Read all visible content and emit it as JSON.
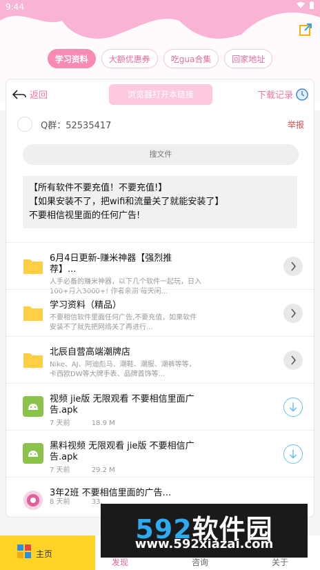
{
  "status_bar": {
    "time": "9:44"
  },
  "tabs": [
    {
      "label": "学习资料"
    },
    {
      "label": "大额优惠券"
    },
    {
      "label": "吃gua合集"
    },
    {
      "label": "回家地址"
    }
  ],
  "nav": {
    "back_label": "返回",
    "open_browser_label": "浏览器打开本链接",
    "download_label": "下载记录"
  },
  "group": {
    "qq_text": "Q群：52535417",
    "report_label": "举报"
  },
  "search": {
    "placeholder": "搜文件"
  },
  "notice": {
    "line1": "【所有软件不要充值！不要充值!】",
    "line2": "【如果安装不了，把wifi和流量关了就能安装了】",
    "line3": "不要相信视里面的任何广告!"
  },
  "files": [
    {
      "title": "6月4日更新-赚米神器【强烈推荐】...",
      "desc": "人手必备的赚米神器，以下几个软件一起玩，日入100+月入3000+! 作者亲测 每天闲...",
      "icon": "folder-icon",
      "action": "chevron-right-icon"
    },
    {
      "title": "学习资料（精品）",
      "desc": "不要相信软件里面任何广告,不要充值，如果软件安装不了就先把网络关了再进行...",
      "icon": "folder-icon",
      "action": "chevron-right-icon"
    },
    {
      "title": "北辰自营高端潮牌店",
      "desc": "Nike、AJ、阿迪彪马、潮鞋、潮服、潮裤等等，卡西欧DW等大牌手表、品牌首饰等...",
      "icon": "folder-icon",
      "action": "chevron-right-icon"
    },
    {
      "title": "视频 jie版 无限观看 不要相信里面广告.apk",
      "time": "7 天前",
      "size": "18.9 M",
      "icon": "android-icon",
      "action": "download-icon"
    },
    {
      "title": "黑料视频 无限观看 jie版 不要相信广告.apk",
      "time": "7 天前",
      "size": "29.2 M",
      "icon": "android-icon",
      "action": "download-icon"
    },
    {
      "title": "3年2班 不要相信里面的广告...",
      "time": "8 天前",
      "size": "33.",
      "icon": "app-icon",
      "action": "download-icon"
    }
  ],
  "bottom_nav": {
    "home": "主页",
    "discover": "发现",
    "consult": "咨询",
    "about": "关于"
  },
  "watermark": {
    "brand_num": "592",
    "brand_cn": "软件园",
    "url": "www.592xiazai.com"
  },
  "colors": {
    "header_pink": "#f9b3d3",
    "accent_pink": "#f68bb4",
    "home_yellow": "#ffd426",
    "download_blue": "#66bff0"
  }
}
